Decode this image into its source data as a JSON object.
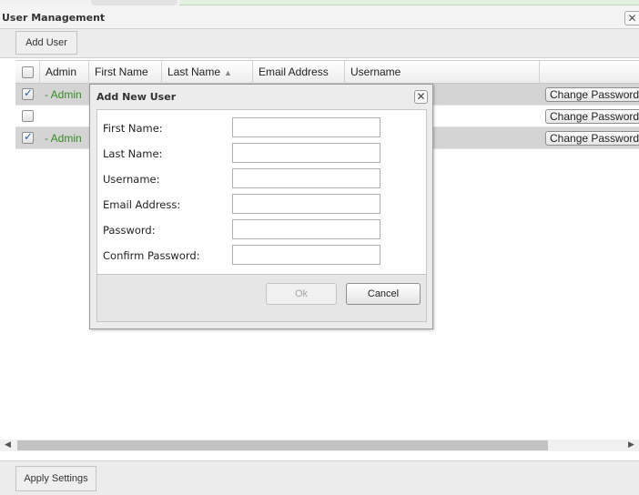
{
  "window": {
    "title": "User Management",
    "close_glyph": "✕"
  },
  "toolbar": {
    "add_user_label": "Add User"
  },
  "grid": {
    "columns": [
      "Admin",
      "First Name",
      "Last Name",
      "Email Address",
      "Username"
    ],
    "sort_indicator": "▲",
    "rows": [
      {
        "checked": true,
        "admin_text": "- Admin",
        "action_label": "Change Password"
      },
      {
        "checked": false,
        "admin_text": "",
        "action_label": "Change Password"
      },
      {
        "checked": true,
        "admin_text": "- Admin",
        "action_label": "Change Password"
      }
    ]
  },
  "scrollbar": {
    "left_arrow": "◀",
    "right_arrow": "▶"
  },
  "footer": {
    "apply_label": "Apply Settings"
  },
  "dialog": {
    "title": "Add New User",
    "close_glyph": "✕",
    "fields": [
      {
        "label": "First Name:",
        "value": ""
      },
      {
        "label": "Last Name:",
        "value": ""
      },
      {
        "label": "Username:",
        "value": ""
      },
      {
        "label": "Email Address:",
        "value": ""
      },
      {
        "label": "Password:",
        "value": ""
      },
      {
        "label": "Confirm Password:",
        "value": ""
      }
    ],
    "ok_label": "Ok",
    "cancel_label": "Cancel"
  },
  "colors": {
    "admin_text": "#3b8a2c",
    "selected_row": "#d4d4d4",
    "checkbox_check": "#2a5fb8"
  }
}
